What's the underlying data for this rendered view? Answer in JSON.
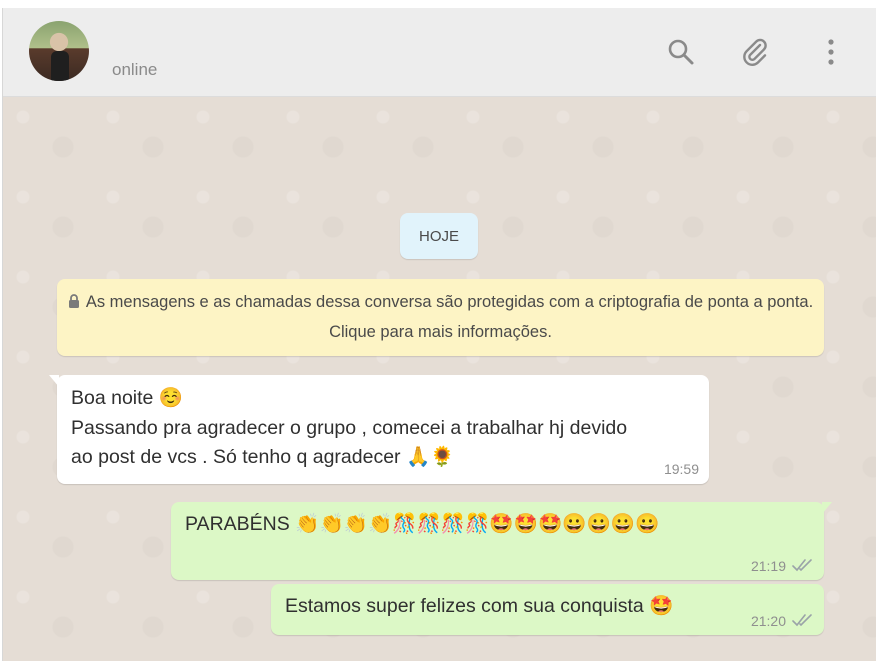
{
  "header": {
    "status": "online",
    "icons": [
      "search-icon",
      "paperclip-icon",
      "menu-dots-icon"
    ]
  },
  "conversation": {
    "date_label": "HOJE",
    "encryption_notice": "As mensagens e as chamadas dessa conversa são protegidas com a criptografia de ponta a ponta. Clique para mais informações.",
    "messages": [
      {
        "direction": "incoming",
        "lines": [
          "Boa noite ☺️",
          "Passando pra agradecer o grupo , comecei a trabalhar hj devido",
          "ao post de vcs . Só tenho q agradecer 🙏🌻"
        ],
        "time": "19:59"
      },
      {
        "direction": "outgoing",
        "text": "PARABÉNS 👏👏👏👏🎊🎊🎊🎊🤩🤩🤩😀😀😀😀",
        "time": "21:19",
        "read": true
      },
      {
        "direction": "outgoing",
        "text": "Estamos super felizes com sua conquista 🤩",
        "time": "21:20",
        "read": true
      }
    ]
  },
  "colors": {
    "chat_bg": "#e5ddd5",
    "incoming_bubble": "#ffffff",
    "outgoing_bubble": "#dcf8c6",
    "notice_bg": "#fdf4c5",
    "date_pill": "#e1f3fb",
    "read_tick": "#9aa3a8"
  }
}
